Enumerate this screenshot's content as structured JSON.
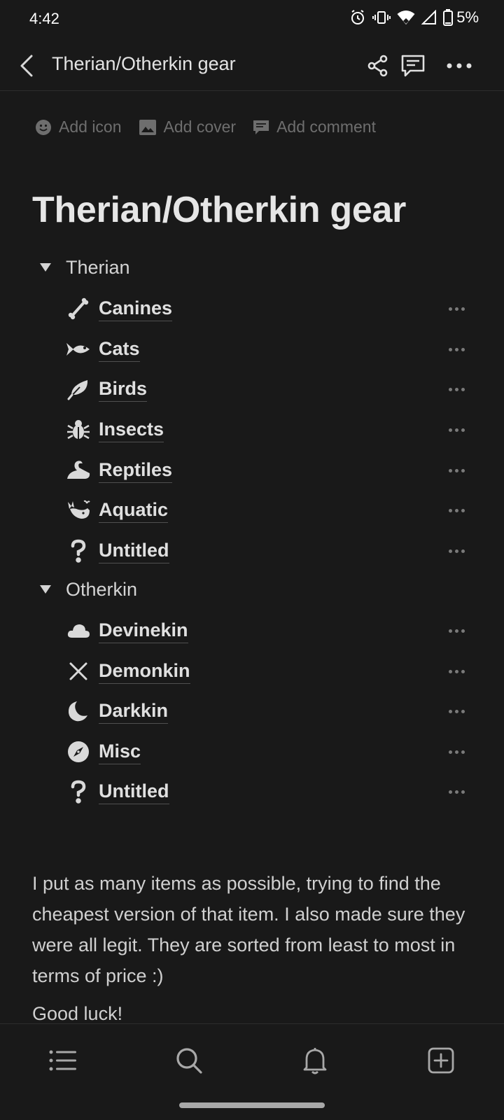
{
  "status_bar": {
    "time": "4:42",
    "battery_percent": "5%"
  },
  "top_bar": {
    "title": "Therian/Otherkin gear"
  },
  "page_actions": {
    "add_icon": "Add icon",
    "add_cover": "Add cover",
    "add_comment": "Add comment"
  },
  "page": {
    "title": "Therian/Otherkin gear"
  },
  "sections": [
    {
      "label": "Therian",
      "items": [
        {
          "label": "Canines",
          "icon": "bone-icon"
        },
        {
          "label": "Cats",
          "icon": "fish-icon"
        },
        {
          "label": "Birds",
          "icon": "feather-icon"
        },
        {
          "label": "Insects",
          "icon": "bug-icon"
        },
        {
          "label": "Reptiles",
          "icon": "snake-icon"
        },
        {
          "label": "Aquatic",
          "icon": "whale-icon"
        },
        {
          "label": "Untitled",
          "icon": "question-icon"
        }
      ]
    },
    {
      "label": "Otherkin",
      "items": [
        {
          "label": "Devinekin",
          "icon": "cloud-icon"
        },
        {
          "label": "Demonkin",
          "icon": "x-icon"
        },
        {
          "label": "Darkkin",
          "icon": "moon-icon"
        },
        {
          "label": "Misc",
          "icon": "compass-icon"
        },
        {
          "label": "Untitled",
          "icon": "question-icon"
        }
      ]
    }
  ],
  "body_text": {
    "paragraph": "I put as many items as possible, trying to find the cheapest version of that item. I also made sure they were all legit. They are sorted from least to most in terms of price :)",
    "closing": "Good luck!"
  },
  "colors": {
    "background": "#191919",
    "text": "#d4d4d4",
    "muted": "#6e6e6e"
  }
}
